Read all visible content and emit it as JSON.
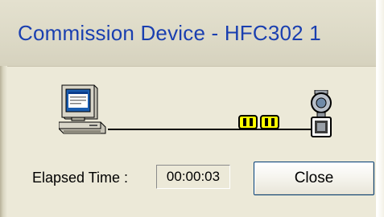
{
  "window": {
    "title": "Commission Device - HFC302 1"
  },
  "icons": {
    "computer": "computer-icon",
    "connector": "modem-connector-icon",
    "device": "field-device-icon"
  },
  "elapsed": {
    "label": "Elapsed Time :",
    "value": "00:00:03"
  },
  "buttons": {
    "close_label": "Close"
  },
  "colors": {
    "title_text": "#1a3fb0",
    "dialog_background": "#ece9d8",
    "connector_yellow": "#ffff00"
  }
}
